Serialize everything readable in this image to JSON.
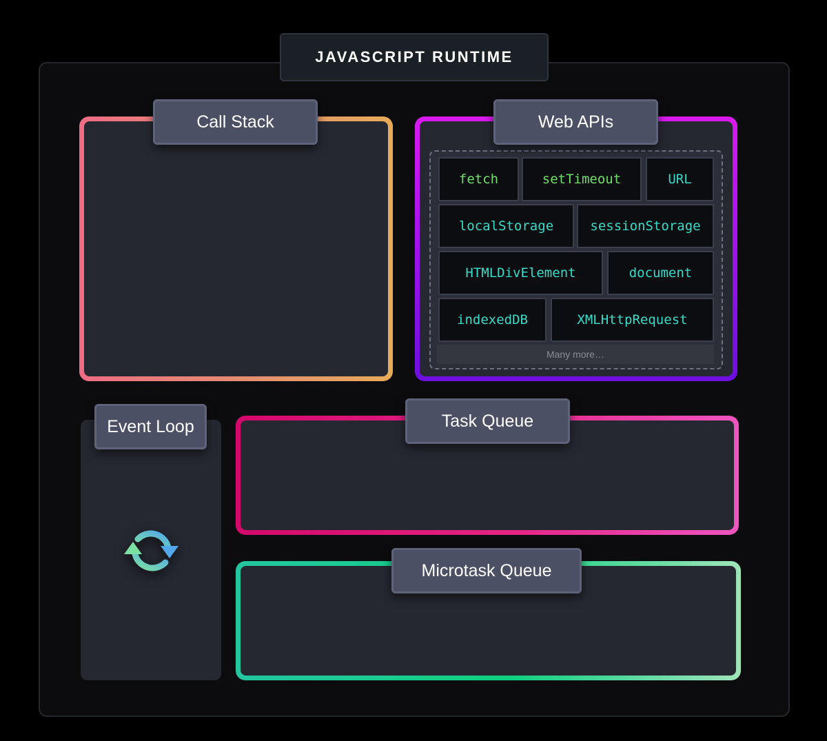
{
  "runtime": {
    "title": "JAVASCRIPT RUNTIME"
  },
  "call_stack": {
    "label": "Call Stack",
    "border_colors": [
      "#ee6c84",
      "#e7ab58"
    ]
  },
  "web_apis": {
    "label": "Web APIs",
    "border_colors": [
      "#d91aee",
      "#6c0fdf"
    ],
    "apis": [
      {
        "name": "fetch",
        "color": "#6fe068"
      },
      {
        "name": "setTimeout",
        "color": "#6fe068"
      },
      {
        "name": "URL",
        "color": "#36dcc7"
      },
      {
        "name": "localStorage",
        "color": "#36dcc7"
      },
      {
        "name": "sessionStorage",
        "color": "#36dcc7"
      },
      {
        "name": "HTMLDivElement",
        "color": "#36dcc7"
      },
      {
        "name": "document",
        "color": "#36dcc7"
      },
      {
        "name": "indexedDB",
        "color": "#36dcc7"
      },
      {
        "name": "XMLHttpRequest",
        "color": "#36dcc7"
      }
    ],
    "more_label": "Many more…"
  },
  "event_loop": {
    "label": "Event Loop",
    "icon": "refresh-cycle-icon"
  },
  "task_queue": {
    "label": "Task Queue",
    "border_colors": [
      "#d4086c",
      "#ef55bf"
    ]
  },
  "microtask_queue": {
    "label": "Microtask Queue",
    "border_colors": [
      "#24c6a0",
      "#9fe4b9"
    ]
  }
}
